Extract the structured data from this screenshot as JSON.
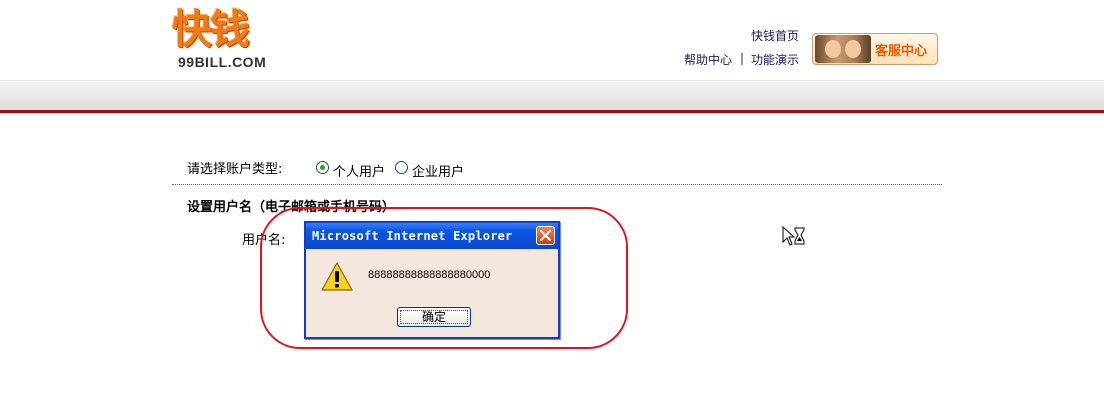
{
  "logo": {
    "main": "快钱",
    "sub": "99BILL.COM"
  },
  "header": {
    "home_link": "快钱首页",
    "help_link": "帮助中心",
    "separator": "|",
    "demo_link": "功能演示",
    "customer_service": "客服中心"
  },
  "form": {
    "account_type_label": "请选择账户类型:",
    "account_types": [
      {
        "label": "个人用户",
        "selected": true
      },
      {
        "label": "企业用户",
        "selected": false
      }
    ],
    "section_title": "设置用户名（电子邮箱或手机号码）",
    "username_label": "用户名:"
  },
  "dialog": {
    "title": "Microsoft Internet Explorer",
    "message": "88888888888888880000",
    "ok_label": "确定",
    "icon": "warning-icon"
  },
  "colors": {
    "brand_orange": "#f07a1a",
    "header_red_line": "#a50a0a",
    "dialog_title_blue": "#0a4fd9",
    "annotation_red": "#e0141e"
  }
}
